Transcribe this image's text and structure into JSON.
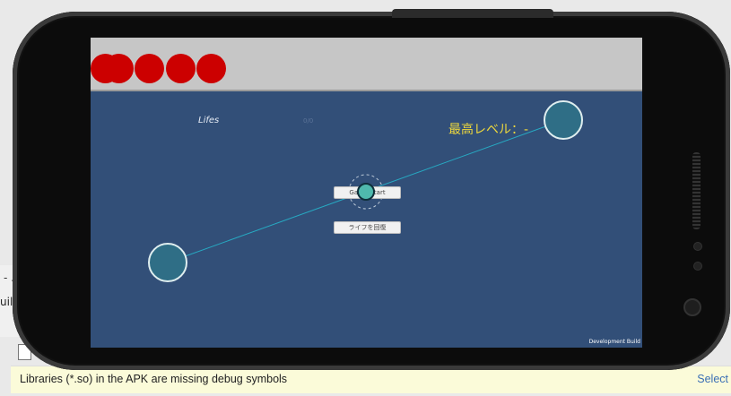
{
  "ide": {
    "partial_title": "- ..",
    "partial_build": "uild",
    "notification": "Libraries (*.so) in the APK are missing debug symbols",
    "select_link": "Select"
  },
  "game": {
    "lives_count": 5,
    "life_color": "#cc0000",
    "lifes_label": "Lifes",
    "lifes_value": "0/0",
    "max_level_label": "最高レベル：-",
    "start_button": "Game Start",
    "recover_button": "ライフを回復",
    "dev_build": "Development Build"
  },
  "colors": {
    "screen_bg": "#324f78",
    "top_bar": "#c6c6c6",
    "accent_text": "#ecd73d",
    "node_fill": "#2f6e86",
    "link_line": "#27a9c2"
  }
}
